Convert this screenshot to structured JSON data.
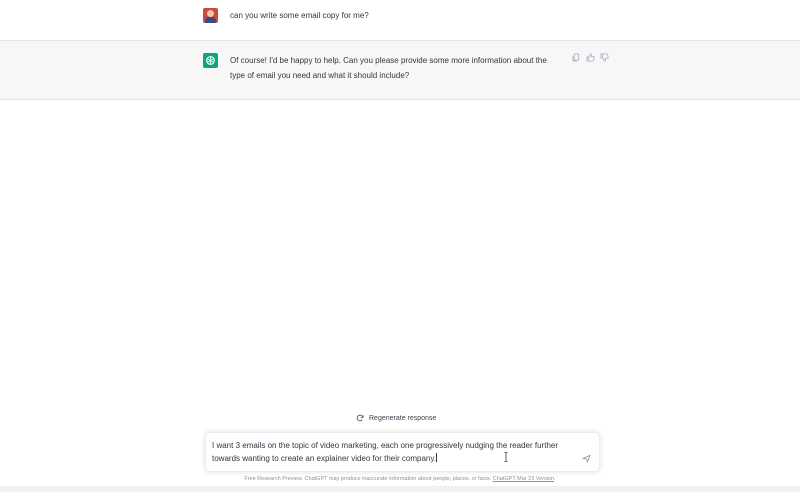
{
  "conversation": {
    "user_message": "can you write some email copy for me?",
    "assistant_message": "Of course! I'd be happy to help. Can you please provide some more information about the type of email you need and what it should include?"
  },
  "message_actions": {
    "icons": [
      "copy-icon",
      "thumbs-up-icon",
      "thumbs-down-icon"
    ]
  },
  "regenerate": {
    "label": "Regenerate response",
    "icon": "refresh-icon"
  },
  "composer": {
    "value": "I want 3 emails on the topic of video marketing, each one progressively nudging the reader further towards wanting to create an explainer video for their company.",
    "send_icon": "send-icon"
  },
  "footer": {
    "text": "Free Research Preview. ChatGPT may produce inaccurate information about people, places, or facts.",
    "link": "ChatGPT Mar 23 Version"
  },
  "colors": {
    "assistant_bg": "#f7f7f8",
    "bot_avatar": "#10a37f",
    "text": "#343541",
    "muted": "#8e8ea0"
  }
}
